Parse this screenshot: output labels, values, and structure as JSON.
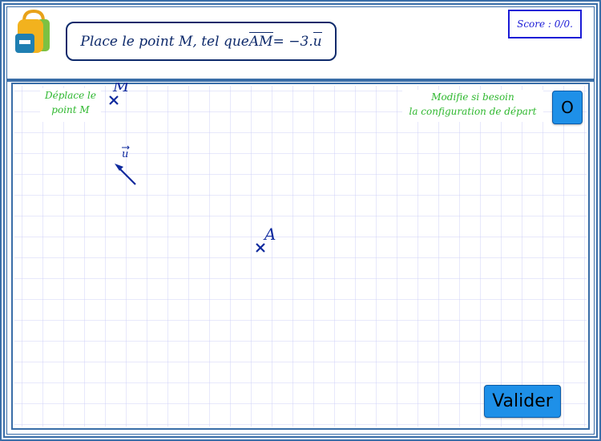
{
  "header": {
    "instruction": {
      "prefix": "Place le point M, tel que ",
      "vector": "AM",
      "suffix": " = −3.",
      "u_vector": "u"
    },
    "score": "Score : 0/0."
  },
  "hints": {
    "move_line1": "Déplace le",
    "move_line2": "point M",
    "modify_line1": "Modifie si besoin",
    "modify_line2": "la configuration de départ"
  },
  "buttons": {
    "reset_label": "O",
    "validate_label": "Valider"
  },
  "points": {
    "M_label": "M",
    "A_label": "A",
    "u_label": "u"
  },
  "colors": {
    "frame": "#3a6ea8",
    "grid": "#cfd0f7",
    "points": "#0f2a9e",
    "hint_text": "#2fb82f",
    "button": "#1e90e8",
    "score": "#1a1ad6"
  },
  "icons": {
    "logo": "school-bag-icon"
  }
}
